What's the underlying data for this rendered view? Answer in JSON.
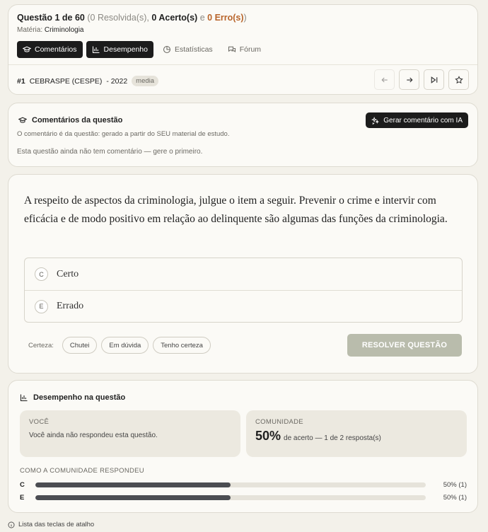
{
  "header": {
    "question_label": "Questão 1 de 60",
    "resolved": "(0 Resolvida(s),",
    "correct": "0 Acerto(s)",
    "correct_sep": "e",
    "errors": "0 Erro(s)",
    "errors_close": ")",
    "subject_label": "Matéria:",
    "subject_value": "Criminologia",
    "tabs": [
      {
        "label": "Comentários",
        "icon": "graduation-cap-icon",
        "active": true
      },
      {
        "label": "Desempenho",
        "icon": "bar-chart-icon",
        "active": true
      },
      {
        "label": "Estatísticas",
        "icon": "pie-chart-icon",
        "active": false
      },
      {
        "label": "Fórum",
        "icon": "chat-bubbles-icon",
        "active": false
      }
    ],
    "number": "#1",
    "board": "CEBRASPE (CESPE)",
    "year": "- 2022",
    "difficulty": "media"
  },
  "comments": {
    "title": "Comentários da questão",
    "subtitle": "O comentário é da questão: gerado a partir do SEU material de estudo.",
    "empty": "Esta questão ainda não tem comentário — gere o primeiro.",
    "ai_button": "Gerar comentário com IA"
  },
  "question": {
    "statement": "A respeito de aspectos da criminologia, julgue o item a seguir. Prevenir o crime e intervir com eficácia e de modo positivo em relação ao delinquente são algumas das funções da criminologia.",
    "options": [
      {
        "letter": "C",
        "text": "Certo"
      },
      {
        "letter": "E",
        "text": "Errado"
      }
    ],
    "certainty_label": "Certeza:",
    "certainty_options": [
      "Chutei",
      "Em dúvida",
      "Tenho certeza"
    ],
    "resolve_button": "RESOLVER QUESTÃO"
  },
  "performance": {
    "title": "Desempenho na questão",
    "you_label": "VOCÊ",
    "you_message": "Você ainda não respondeu esta questão.",
    "community_label": "COMUNIDADE",
    "community_pct": "50%",
    "community_detail": "de acerto — 1 de 2 resposta(s)",
    "how_title": "COMO A COMUNIDADE RESPONDEU",
    "bars": [
      {
        "letter": "C",
        "fraction": 0.5,
        "value": "50% (1)"
      },
      {
        "letter": "E",
        "fraction": 0.5,
        "value": "50% (1)"
      }
    ]
  },
  "footer": {
    "shortcuts": "Lista das teclas de atalho"
  },
  "colors": {
    "accent_dark": "#1c1c1c",
    "error_orange": "#b8642a",
    "resolve_disabled": "#b9bcac",
    "bar_fill": "#4b4d52"
  }
}
